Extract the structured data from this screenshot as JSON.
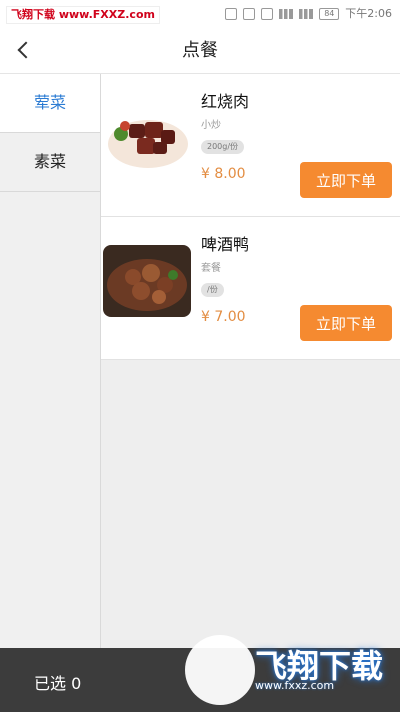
{
  "status_bar": {
    "watermark_top": "飞翔下载 www.FXXZ.com",
    "battery": "84",
    "time": "下午2:06"
  },
  "header": {
    "title": "点餐"
  },
  "categories": [
    {
      "label": "荤菜"
    },
    {
      "label": "素菜"
    }
  ],
  "items": [
    {
      "name": "红烧肉",
      "sub": "小炒",
      "spec": "200g/份",
      "price": "¥ 8.00",
      "button": "立即下单"
    },
    {
      "name": "啤酒鸭",
      "sub": "套餐",
      "spec": "/份",
      "price": "¥ 7.00",
      "button": "立即下单"
    }
  ],
  "bottom": {
    "selected": "已选 0"
  },
  "watermark_bottom": {
    "name": "飞翔下载",
    "url": "www.fxxz.com"
  }
}
